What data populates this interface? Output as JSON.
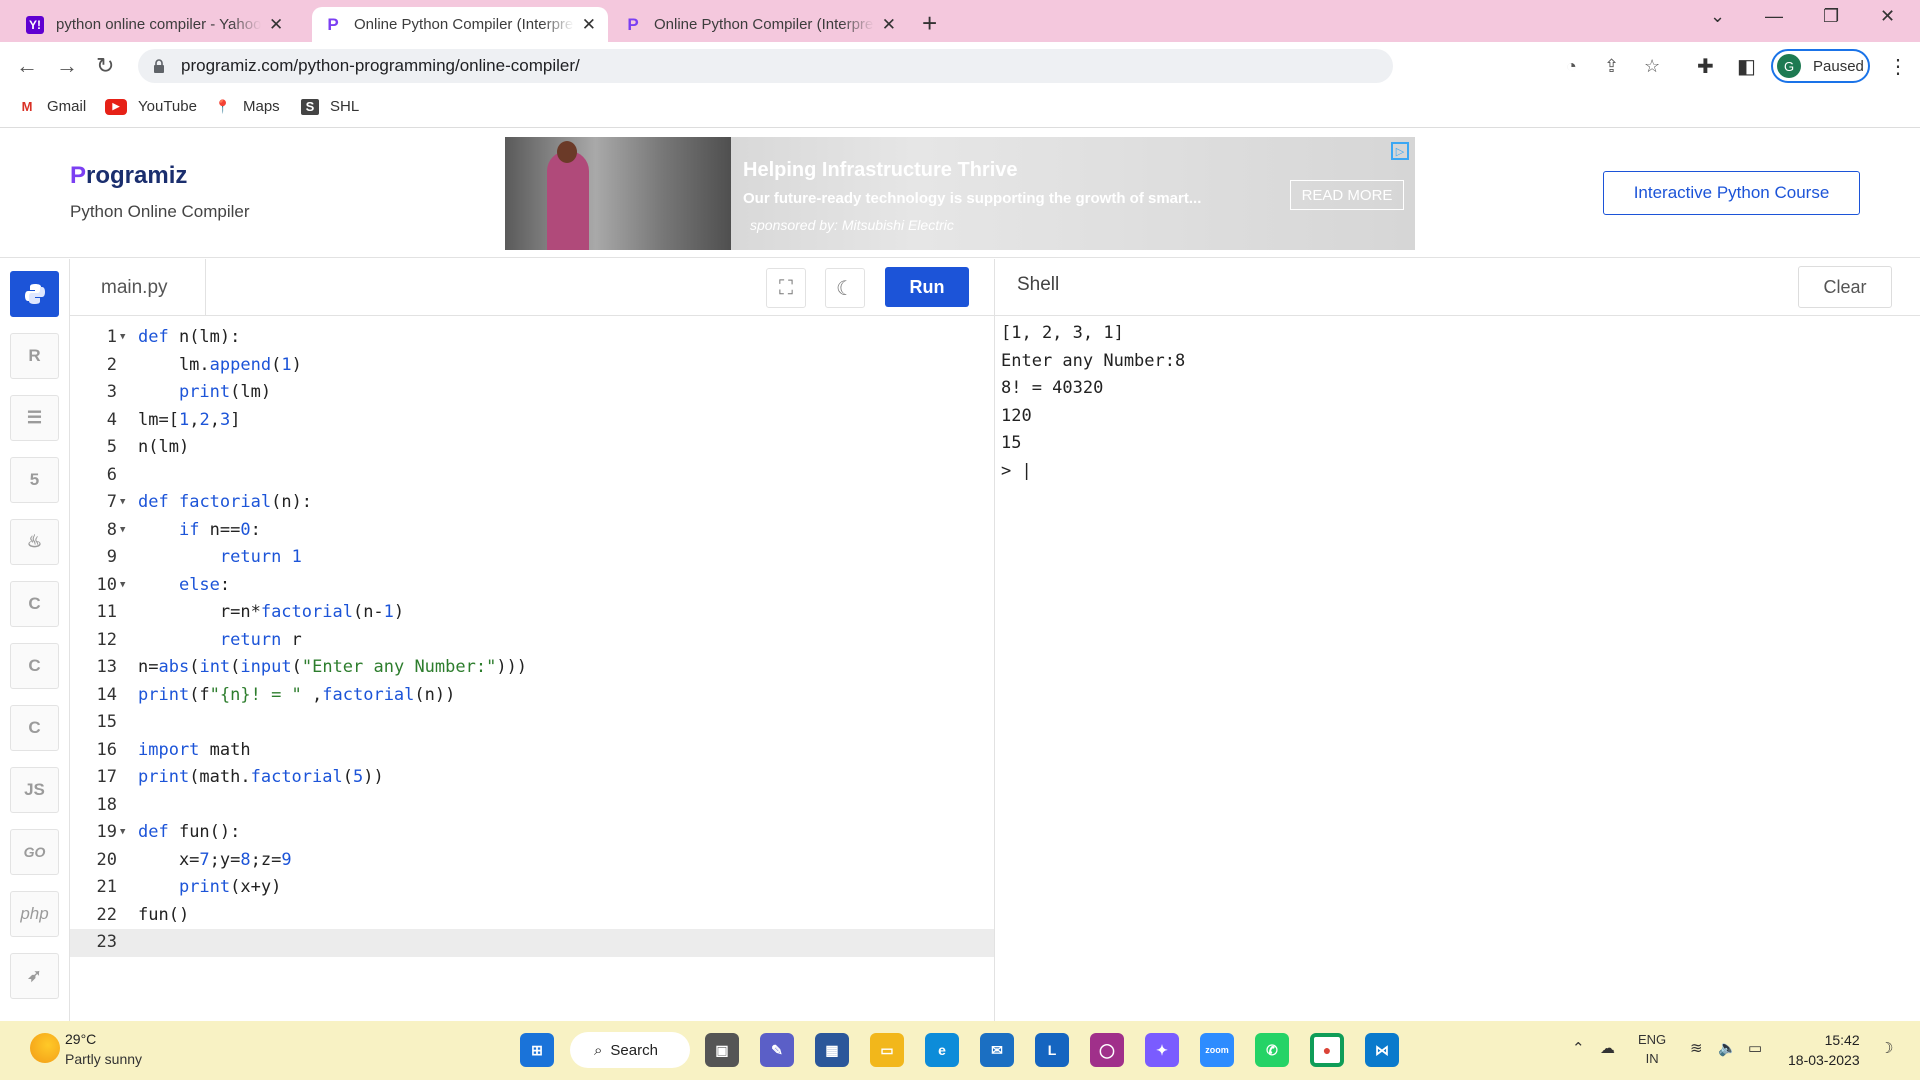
{
  "browser": {
    "tabs": [
      {
        "title": "python online compiler - Yahoo Search Results",
        "favicon": "Y!"
      },
      {
        "title": "Online Python Compiler (Interpreter)",
        "favicon": "P"
      },
      {
        "title": "Online Python Compiler (Interpreter)",
        "favicon": "P"
      }
    ],
    "url": "programiz.com/python-programming/online-compiler/",
    "profile_initial": "G",
    "profile_status": "Paused"
  },
  "bookmarks": [
    {
      "label": "Gmail",
      "icon": "gmail-icon"
    },
    {
      "label": "YouTube",
      "icon": "youtube-icon"
    },
    {
      "label": "Maps",
      "icon": "maps-icon"
    },
    {
      "label": "SHL",
      "icon": "shl-icon"
    }
  ],
  "site": {
    "logo_letter": "P",
    "logo_rest": "rogramiz",
    "subtitle": "Python Online Compiler",
    "course_button": "Interactive Python Course"
  },
  "ad": {
    "headline": "Helping Infrastructure Thrive",
    "body": "Our future-ready technology is supporting the growth of smart...",
    "sponsor": "sponsored by: Mitsubishi Electric",
    "cta": "READ MORE"
  },
  "sidebar_languages": [
    "python",
    "r",
    "sql",
    "html",
    "java",
    "c",
    "cpp",
    "csharp",
    "JS",
    "GO",
    "php",
    "swift"
  ],
  "editor": {
    "filename": "main.py",
    "run_label": "Run",
    "lines": [
      "def n(lm):",
      "    lm.append(1)",
      "    print(lm)",
      "lm=[1,2,3]",
      "n(lm)",
      "",
      "def factorial(n):",
      "    if n==0:",
      "        return 1",
      "    else:",
      "        r=n*factorial(n-1)",
      "        return r",
      "n=abs(int(input(\"Enter any Number:\")))",
      "print(f\"{n}! = \" ,factorial(n))",
      "",
      "import math",
      "print(math.factorial(5))",
      "",
      "def fun():",
      "    x=7;y=8;z=9",
      "    print(x+y)",
      "fun()",
      ""
    ],
    "fold_lines": [
      1,
      7,
      8,
      10,
      19
    ],
    "current_line": 23
  },
  "shell": {
    "title": "Shell",
    "clear_label": "Clear",
    "output": [
      "[1, 2, 3, 1]",
      "Enter any Number:8",
      "8! = 40320",
      "120",
      "15",
      "> |"
    ]
  },
  "taskbar": {
    "temperature": "29°C",
    "weather": "Partly sunny",
    "search_label": "Search",
    "lang_line1": "ENG",
    "lang_line2": "IN",
    "time": "15:42",
    "date": "18-03-2023"
  }
}
